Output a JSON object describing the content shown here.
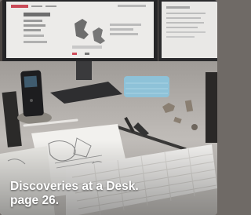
{
  "caption": {
    "line1": "Discoveries at a Desk.",
    "line2": "page 26."
  },
  "colors": {
    "desk": "#c9c6c2",
    "monitor_frame": "#2b2b2d",
    "screen": "#eceae8",
    "caption_text": "#ffffff"
  }
}
